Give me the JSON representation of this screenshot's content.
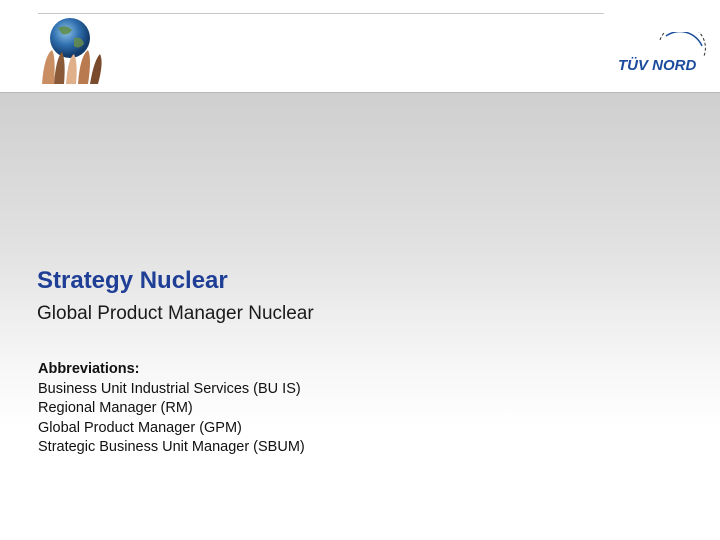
{
  "header": {
    "brand_logo_text": "TÜV NORD"
  },
  "slide": {
    "title": "Strategy Nuclear",
    "subtitle": "Global Product Manager Nuclear",
    "abbreviations": {
      "heading": "Abbreviations:",
      "items": [
        "Business Unit Industrial Services (BU IS)",
        "Regional Manager (RM)",
        "Global Product Manager (GPM)",
        "Strategic Business Unit Manager (SBUM)"
      ]
    }
  },
  "colors": {
    "title": "#1f3f96",
    "logo_blue": "#1a4b9c"
  }
}
